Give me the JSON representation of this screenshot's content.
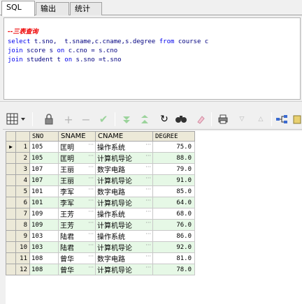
{
  "tabs": [
    {
      "label": "SQL",
      "active": true
    },
    {
      "label": "输出",
      "active": false
    },
    {
      "label": "统计",
      "active": false
    }
  ],
  "editor": {
    "comment": "--三表查询",
    "line2": {
      "kw1": "select",
      "t1": " t.sno,  t.sname,c.cname,s.degree ",
      "kw2": "from",
      "t2": " course c"
    },
    "line3": {
      "kw1": "join",
      "t1": " score s ",
      "kw2": "on",
      "t2": " c.cno = s.cno"
    },
    "line4": {
      "kw1": "join",
      "t1": " student t ",
      "kw2": "on",
      "t2": " s.sno =t.sno"
    }
  },
  "toolbar": {
    "icons": [
      "grid-menu-icon",
      "lock-icon",
      "add-icon",
      "remove-icon",
      "post-icon",
      "filter-down-icon",
      "filter-up-icon",
      "refresh-icon",
      "find-icon",
      "clear-icon",
      "print-icon",
      "triangle-down-icon",
      "triangle-up-icon",
      "link-icon",
      "export-icon"
    ]
  },
  "grid": {
    "columns": [
      "SNO",
      "SNAME",
      "CNAME",
      "DEGREE"
    ],
    "rows": [
      {
        "n": "1",
        "sno": "105",
        "sname": "匡明",
        "cname": "操作系统",
        "degree": "75.0"
      },
      {
        "n": "2",
        "sno": "105",
        "sname": "匡明",
        "cname": "计算机导论",
        "degree": "88.0"
      },
      {
        "n": "3",
        "sno": "107",
        "sname": "王丽",
        "cname": "数字电路",
        "degree": "79.0"
      },
      {
        "n": "4",
        "sno": "107",
        "sname": "王丽",
        "cname": "计算机导论",
        "degree": "91.0"
      },
      {
        "n": "5",
        "sno": "101",
        "sname": "李军",
        "cname": "数字电路",
        "degree": "85.0"
      },
      {
        "n": "6",
        "sno": "101",
        "sname": "李军",
        "cname": "计算机导论",
        "degree": "64.0"
      },
      {
        "n": "7",
        "sno": "109",
        "sname": "王芳",
        "cname": "操作系统",
        "degree": "68.0"
      },
      {
        "n": "8",
        "sno": "109",
        "sname": "王芳",
        "cname": "计算机导论",
        "degree": "76.0"
      },
      {
        "n": "9",
        "sno": "103",
        "sname": "陆君",
        "cname": "操作系统",
        "degree": "86.0"
      },
      {
        "n": "10",
        "sno": "103",
        "sname": "陆君",
        "cname": "计算机导论",
        "degree": "92.0"
      },
      {
        "n": "11",
        "sno": "108",
        "sname": "曾华",
        "cname": "数字电路",
        "degree": "81.0"
      },
      {
        "n": "12",
        "sno": "108",
        "sname": "曾华",
        "cname": "计算机导论",
        "degree": "78.0"
      }
    ]
  }
}
